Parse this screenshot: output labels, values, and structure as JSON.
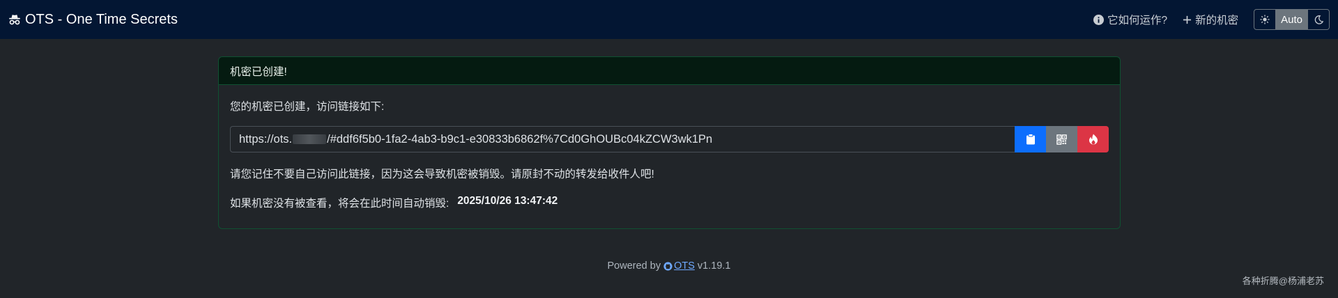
{
  "navbar": {
    "brand": "OTS - One Time Secrets",
    "how_it_works": "它如何运作?",
    "new_secret": "新的机密",
    "theme": {
      "options": [
        "light",
        "Auto",
        "dark"
      ],
      "selected": "Auto"
    }
  },
  "card": {
    "header": "机密已创建!",
    "intro": "您的机密已创建，访问链接如下:",
    "url_prefix": "https://ots.",
    "url_suffix": "/#ddf6f5b0-1fa2-4ab3-b9c1-e30833b6862f%7Cd0GhOUBc04kZCW3wk1Pn",
    "warning": "请您记住不要自己访问此链接，因为这会导致机密被销毁。请原封不动的转发给收件人吧!",
    "expire_label": "如果机密没有被查看，将会在此时间自动销毁:",
    "expire_value": "2025/10/26 13:47:42"
  },
  "footer": {
    "powered_by": "Powered by",
    "link_text": "OTS",
    "version": "v1.19.1"
  },
  "watermark": "各种折腾@杨浦老苏",
  "colors": {
    "navbar_bg": "#031633",
    "page_bg": "#212529",
    "success_border": "#0f5132",
    "copy_button": "#0d6efd",
    "qr_button": "#6c757d",
    "burn_button": "#dc3545",
    "link": "#6ea8fe"
  }
}
